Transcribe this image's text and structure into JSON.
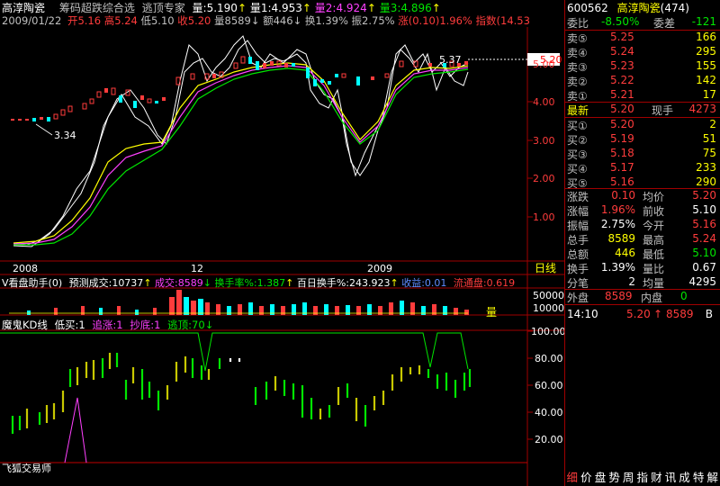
{
  "header": {
    "stock_name": "高淳陶瓷",
    "indicator": "筹码超跌综合选",
    "indicator2": "逃顶专家",
    "vol_label": "量:5.190",
    "vol1": "量1:4.953",
    "vol2": "量2:4.924",
    "vol3": "量3:4.896",
    "date": "2009/01/22",
    "open": "开5.16",
    "high": "高5.24",
    "low": "低5.10",
    "close": "收5.20",
    "volume": "量8589",
    "amount": "额446",
    "turnover": "换1.39%",
    "amplitude": "振2.75%",
    "change": "涨(0.10)1.96%",
    "index": "指数(14.53"
  },
  "main_chart": {
    "y_labels": [
      "5.00",
      "4.00",
      "3.00",
      "2.00",
      "1.00"
    ],
    "price_tag": "5.20",
    "low_annotation": "3.34",
    "high_annotation": "5.37",
    "x_labels": [
      "2008",
      "12",
      "2009"
    ],
    "period_button": "日线"
  },
  "volume_panel": {
    "title": "V看盘助手(0)",
    "forecast": "预测成交:10737",
    "vol": "成交:8589",
    "turnover": "换手率%:1.387",
    "hundred_day": "百日换手%:243.923",
    "profit": "收益:0.01",
    "float": "流通盘:0.619",
    "y_labels": [
      "50000",
      "10000"
    ],
    "side_label": "量"
  },
  "lower_panel": {
    "title": "魔鬼KD线",
    "buy_low": "低买:1",
    "chase": "追涨:1",
    "bottom": "抄底:1",
    "escape": "逃顶:70",
    "y_labels": [
      "100.00",
      "80.00",
      "60.00",
      "40.00",
      "20.00"
    ],
    "watermark": "飞狐交易师"
  },
  "quote_panel": {
    "code": "600562",
    "name": "高淳陶瓷",
    "count": "(474)",
    "wei_bi_label": "委比",
    "wei_bi": "-8.50%",
    "wei_cha_label": "委差",
    "wei_cha": "-121",
    "asks": [
      {
        "label": "卖⑤",
        "price": "5.25",
        "vol": "166"
      },
      {
        "label": "卖④",
        "price": "5.24",
        "vol": "295"
      },
      {
        "label": "卖③",
        "price": "5.23",
        "vol": "155"
      },
      {
        "label": "卖②",
        "price": "5.22",
        "vol": "142"
      },
      {
        "label": "卖①",
        "price": "5.21",
        "vol": "17"
      }
    ],
    "latest_label": "最新",
    "latest": "5.20",
    "now_hand_label": "现手",
    "now_hand": "4273",
    "bids": [
      {
        "label": "买①",
        "price": "5.20",
        "vol": "2"
      },
      {
        "label": "买②",
        "price": "5.19",
        "vol": "51"
      },
      {
        "label": "买③",
        "price": "5.18",
        "vol": "75"
      },
      {
        "label": "买④",
        "price": "5.17",
        "vol": "233"
      },
      {
        "label": "买⑤",
        "price": "5.16",
        "vol": "290"
      }
    ],
    "stats": [
      {
        "l1": "涨跌",
        "v1": "0.10",
        "l2": "均价",
        "v2": "5.20"
      },
      {
        "l1": "涨幅",
        "v1": "1.96%",
        "l2": "前收",
        "v2": "5.10"
      },
      {
        "l1": "振幅",
        "v1": "2.75%",
        "l2": "今开",
        "v2": "5.16"
      },
      {
        "l1": "总手",
        "v1": "8589",
        "l2": "最高",
        "v2": "5.24"
      },
      {
        "l1": "总额",
        "v1": "446",
        "l2": "最低",
        "v2": "5.10"
      },
      {
        "l1": "换手",
        "v1": "1.39%",
        "l2": "量比",
        "v2": "0.67"
      },
      {
        "l1": "分笔",
        "v1": "2",
        "l2": "均量",
        "v2": "4295"
      }
    ],
    "outer_label": "外盘",
    "outer": "8589",
    "inner_label": "内盘",
    "inner": "0",
    "tick_time": "14:10",
    "tick_price": "5.20",
    "tick_vol": "8589",
    "tick_side": "B",
    "bottom_tabs": [
      "细",
      "价",
      "盘",
      "势",
      "周",
      "指",
      "财",
      "讯",
      "成",
      "特",
      "解"
    ]
  }
}
